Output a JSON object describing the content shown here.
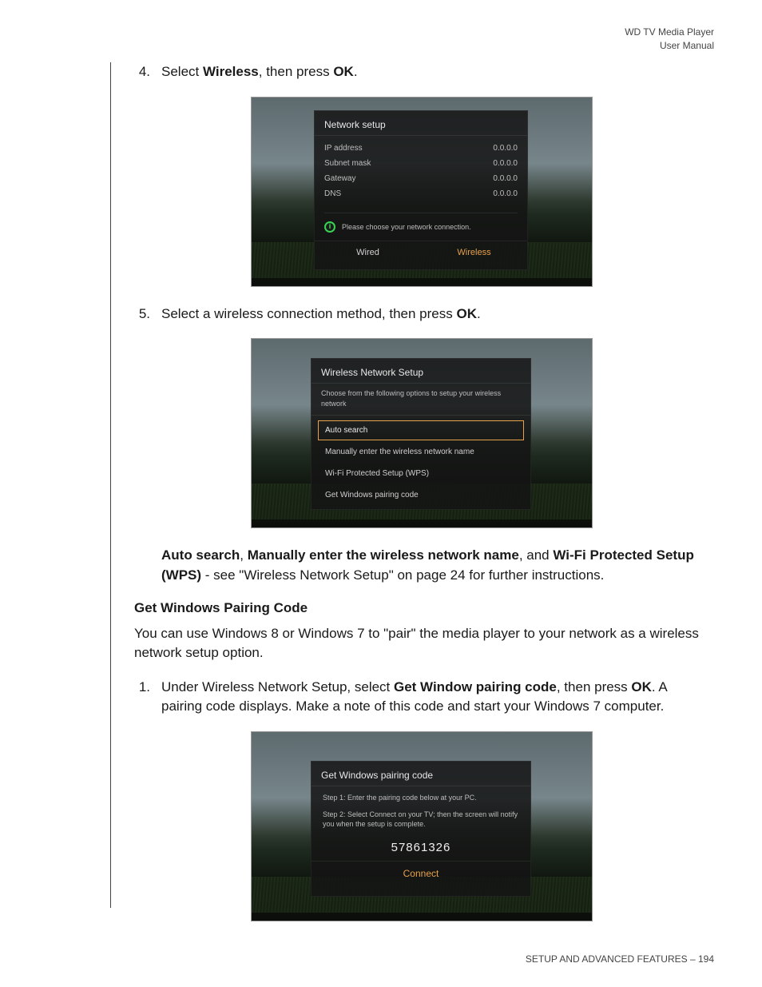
{
  "header": {
    "line1": "WD TV Media Player",
    "line2": "User Manual"
  },
  "step4": {
    "num": "4.",
    "pre": "Select ",
    "bold1": "Wireless",
    "mid": ", then press ",
    "bold2": "OK",
    "post": "."
  },
  "fig1": {
    "title": "Network setup",
    "rows": [
      {
        "label": "IP address",
        "value": "0.0.0.0"
      },
      {
        "label": "Subnet mask",
        "value": "0.0.0.0"
      },
      {
        "label": "Gateway",
        "value": "0.0.0.0"
      },
      {
        "label": "DNS",
        "value": "0.0.0.0"
      }
    ],
    "info": "Please choose your network connection.",
    "btn_wired": "Wired",
    "btn_wireless": "Wireless"
  },
  "step5": {
    "num": "5.",
    "pre": "Select a wireless connection method, then press ",
    "bold": "OK",
    "post": "."
  },
  "fig2": {
    "title": "Wireless Network Setup",
    "subtitle": "Choose from the following options to setup your wireless network",
    "options": [
      "Auto search",
      "Manually enter the wireless network name",
      "Wi-Fi Protected Setup (WPS)",
      "Get Windows pairing code"
    ]
  },
  "para_after_fig2": {
    "b1": "Auto search",
    "t1": ", ",
    "b2": "Manually enter the wireless network name",
    "t2": ", and ",
    "b3": "Wi-Fi Protected Setup (WPS)",
    "t3": " - see \"Wireless Network Setup\" on page 24 for further instructions."
  },
  "section_heading": "Get Windows Pairing Code",
  "section_body": "You can use Windows 8 or Windows 7 to \"pair\" the media player to your network as a wireless network setup option.",
  "step1b": {
    "num": "1.",
    "pre": "Under Wireless Network Setup, select ",
    "bold1": "Get Window pairing code",
    "mid": ", then press ",
    "bold2": "OK",
    "post": ". A pairing code displays. Make a note of this code and start your Windows 7 computer."
  },
  "fig3": {
    "title": "Get Windows pairing code",
    "step1": "Step 1: Enter the pairing code below at your PC.",
    "step2": "Step 2: Select Connect on your TV; then the screen will notify you when the setup is complete.",
    "code": "57861326",
    "connect": "Connect"
  },
  "footer": {
    "section": "SETUP AND ADVANCED FEATURES",
    "sep": " – ",
    "page": "194"
  }
}
